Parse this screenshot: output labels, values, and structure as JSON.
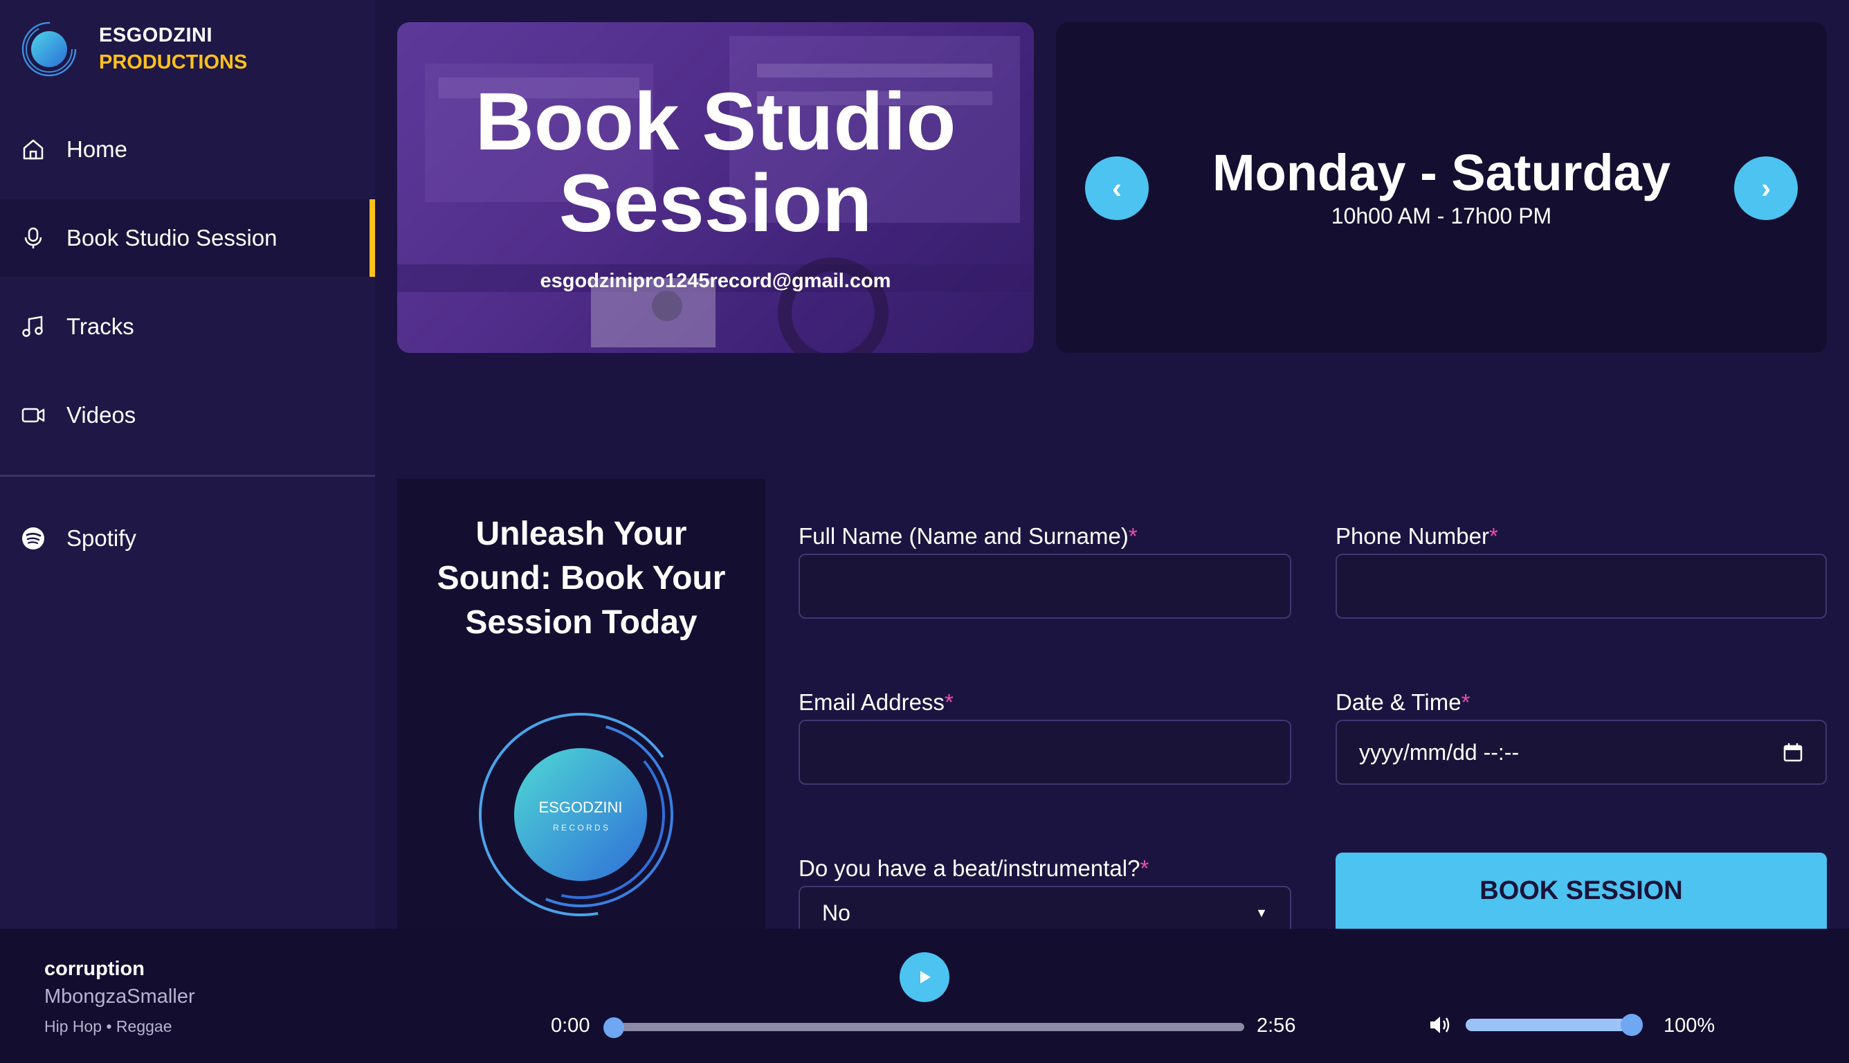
{
  "brand": {
    "line1": "ESGODZINI",
    "line2": "PRODUCTIONS",
    "accent_color": "#ffc21a"
  },
  "sidebar": {
    "items": [
      {
        "label": "Home",
        "icon": "home-icon"
      },
      {
        "label": "Book Studio Session",
        "icon": "microphone-icon",
        "active": true
      },
      {
        "label": "Tracks",
        "icon": "music-note-icon"
      },
      {
        "label": "Videos",
        "icon": "video-camera-icon"
      }
    ],
    "external": [
      {
        "label": "Spotify",
        "icon": "spotify-icon"
      }
    ]
  },
  "hero": {
    "title_line1": "Book Studio",
    "title_line2": "Session",
    "email": "esgodzinipro1245record@gmail.com"
  },
  "schedule": {
    "days": "Monday - Saturday",
    "hours": "10h00 AM - 17h00 PM",
    "prev_icon": "‹",
    "next_icon": "›"
  },
  "promo": {
    "title": "Unleash Your Sound: Book Your Session Today",
    "logo_text1": "ESGODZINI",
    "logo_text2": "R E C O R D S"
  },
  "form": {
    "full_name_label": "Full Name (Name and Surname)",
    "phone_label": "Phone Number",
    "email_label": "Email Address",
    "datetime_label": "Date & Time",
    "datetime_placeholder": "yyyy/mm/dd  --:--",
    "beat_label": "Do you have a beat/instrumental?",
    "beat_value": "No",
    "required_mark": "*",
    "submit_label": "BOOK SESSION",
    "button_color": "#4cc3f0"
  },
  "player": {
    "title": "corruption",
    "artist": "MbongzaSmaller",
    "genre": "Hip Hop • Reggae",
    "current_time": "0:00",
    "total_time": "2:56",
    "volume": "100%",
    "progress_fraction": 0.0,
    "volume_fraction": 1.0
  }
}
